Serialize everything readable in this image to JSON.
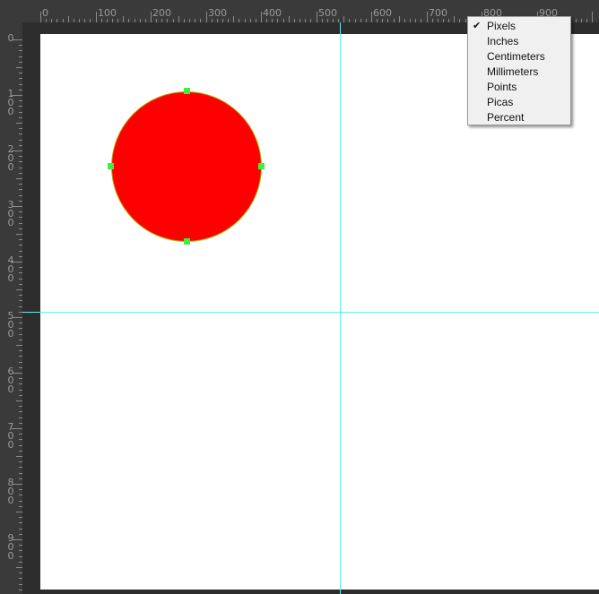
{
  "ruler": {
    "unit": "Pixels",
    "top_labels": [
      "0",
      "100",
      "200",
      "300",
      "400",
      "500",
      "600",
      "700",
      "800",
      "900"
    ],
    "left_labels": [
      "0",
      "100",
      "200",
      "300",
      "400",
      "500",
      "600",
      "700",
      "800",
      "900"
    ]
  },
  "units_menu": {
    "items": [
      {
        "label": "Pixels",
        "checked": true,
        "check": "✔"
      },
      {
        "label": "Inches",
        "checked": false
      },
      {
        "label": "Centimeters",
        "checked": false
      },
      {
        "label": "Millimeters",
        "checked": false
      },
      {
        "label": "Points",
        "checked": false
      },
      {
        "label": "Picas",
        "checked": false
      },
      {
        "label": "Percent",
        "checked": false
      }
    ]
  },
  "shape": {
    "kind": "ellipse",
    "fill": "#ff0000",
    "stroke": "#b8a800",
    "handle_color": "#3ef03e"
  },
  "guide_color": "#5ff0f0",
  "canvas_color": "#ffffff"
}
